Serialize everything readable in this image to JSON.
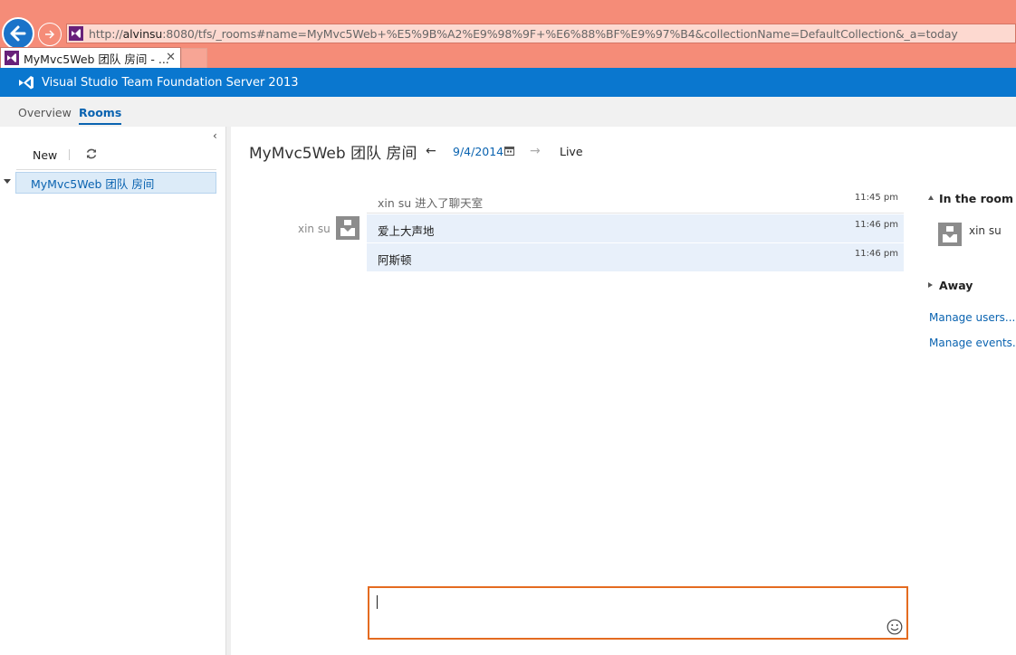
{
  "browser": {
    "url_prefix": "http://",
    "url_host": "alvinsu",
    "url_rest": ":8080/tfs/_rooms#name=MyMvc5Web+%E5%9B%A2%E9%98%9F+%E6%88%BF%E9%97%B4&collectionName=DefaultCollection&_a=today",
    "tab_title": "MyMvc5Web 团队 房间 - ...",
    "tab_close": "✕"
  },
  "header": {
    "brand": "Visual Studio Team Foundation Server 2013"
  },
  "nav": {
    "tabs": [
      {
        "label": "Overview"
      },
      {
        "label": "Rooms"
      }
    ]
  },
  "left": {
    "collapse": "‹",
    "new_label": "New",
    "rooms": [
      {
        "label": "MyMvc5Web 团队 房间"
      }
    ]
  },
  "room": {
    "title": "MyMvc5Web 团队 房间",
    "prev": "←",
    "date": "9/4/2014",
    "next": "→",
    "live": "Live"
  },
  "messages": {
    "system": {
      "text": "xin su 进入了聊天室",
      "time": "11:45 pm"
    },
    "sender": "xin su",
    "items": [
      {
        "text": "爱上大声地",
        "time": "11:46 pm"
      },
      {
        "text": "阿斯顿",
        "time": "11:46 pm"
      }
    ]
  },
  "sidebar": {
    "in_room": "In the room",
    "members": [
      {
        "name": "xin su"
      }
    ],
    "away": "Away",
    "manage_users": "Manage users...",
    "manage_events": "Manage events..."
  },
  "colors": {
    "chrome": "#f58c78",
    "brand_blue": "#0a77cf",
    "link": "#0a63b0",
    "composer_border": "#e46b20",
    "message_bg": "#e8f0fa"
  }
}
